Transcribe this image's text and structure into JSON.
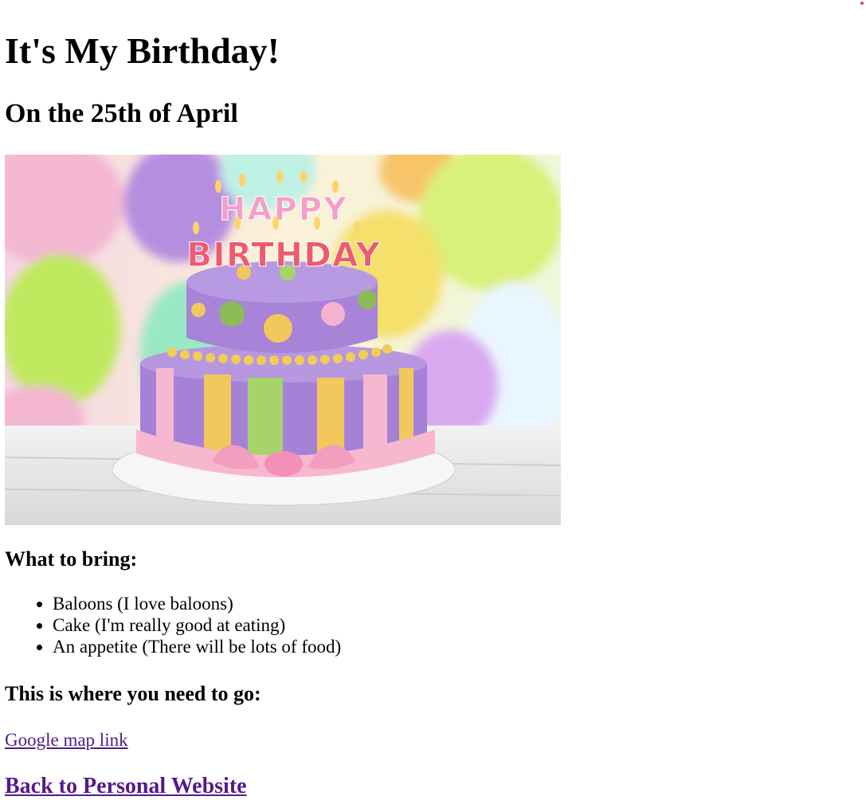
{
  "page": {
    "title": "It's My Birthday!",
    "subtitle": "On the 25th of April"
  },
  "hero_image": {
    "icon": "birthday-cake-image",
    "cake_text_top": "HAPPY",
    "cake_text_bottom": "BIRTHDAY"
  },
  "bring": {
    "heading": "What to bring:",
    "items": [
      "Baloons (I love baloons)",
      "Cake (I'm really good at eating)",
      "An appetite (There will be lots of food)"
    ]
  },
  "location": {
    "heading": "This is where you need to go:",
    "map_link": "Google map link"
  },
  "back_link": "Back to Personal Website",
  "colors": {
    "visited_link": "#551a8b",
    "corner_dot": "#e0403a"
  }
}
